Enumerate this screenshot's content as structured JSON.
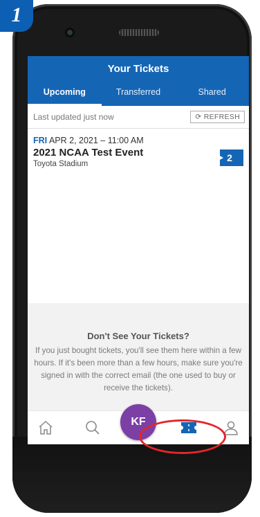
{
  "step": {
    "number": "1"
  },
  "header": {
    "title": "Your Tickets"
  },
  "tabs": [
    {
      "label": "Upcoming",
      "active": true
    },
    {
      "label": "Transferred",
      "active": false
    },
    {
      "label": "Shared",
      "active": false
    }
  ],
  "status": {
    "updated": "Last updated just now",
    "refresh_label": "REFRESH"
  },
  "event": {
    "day": "FRI",
    "datetime": "APR 2, 2021 – 11:00 AM",
    "name": "2021 NCAA Test Event",
    "venue": "Toyota Stadium",
    "ticket_count": "2"
  },
  "info": {
    "title": "Don't See Your Tickets?",
    "text": "If you just bought tickets, you'll see them here within a few hours. If it's been more than a few hours, make sure you're signed in with the correct email (the one used to buy or receive the tickets)."
  },
  "nav": {
    "avatar_initials": "KF",
    "items": [
      "home-icon",
      "search-icon",
      "avatar",
      "tickets-icon",
      "account-icon"
    ]
  },
  "colors": {
    "brand": "#1565b5",
    "avatar": "#7b3fa5",
    "highlight": "#e3262c"
  }
}
